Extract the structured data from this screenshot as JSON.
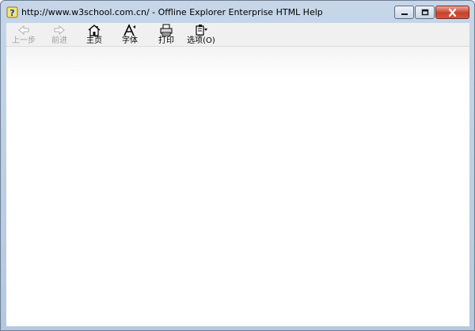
{
  "window": {
    "title": "http://www.w3school.com.cn/ - Offline Explorer Enterprise HTML Help",
    "minimize_icon": "minimize-icon",
    "maximize_icon": "maximize-icon",
    "close_icon": "close-icon",
    "app_icon": "help-question-icon"
  },
  "toolbar": {
    "back": {
      "label": "上一步",
      "icon": "back-arrow-icon",
      "enabled": false
    },
    "forward": {
      "label": "前进",
      "icon": "forward-arrow-icon",
      "enabled": false
    },
    "home": {
      "label": "主页",
      "icon": "home-icon",
      "enabled": true
    },
    "font": {
      "label": "字体",
      "icon": "font-icon",
      "enabled": true
    },
    "print": {
      "label": "打印",
      "icon": "printer-icon",
      "enabled": true
    },
    "options": {
      "label": "选项(O)",
      "icon": "options-icon",
      "enabled": true
    }
  },
  "colors": {
    "titlebar": "#c6d6e8",
    "close_button": "#c8422b",
    "toolbar_bg": "#f0f0f0",
    "disabled_text": "#a0a0a0"
  }
}
